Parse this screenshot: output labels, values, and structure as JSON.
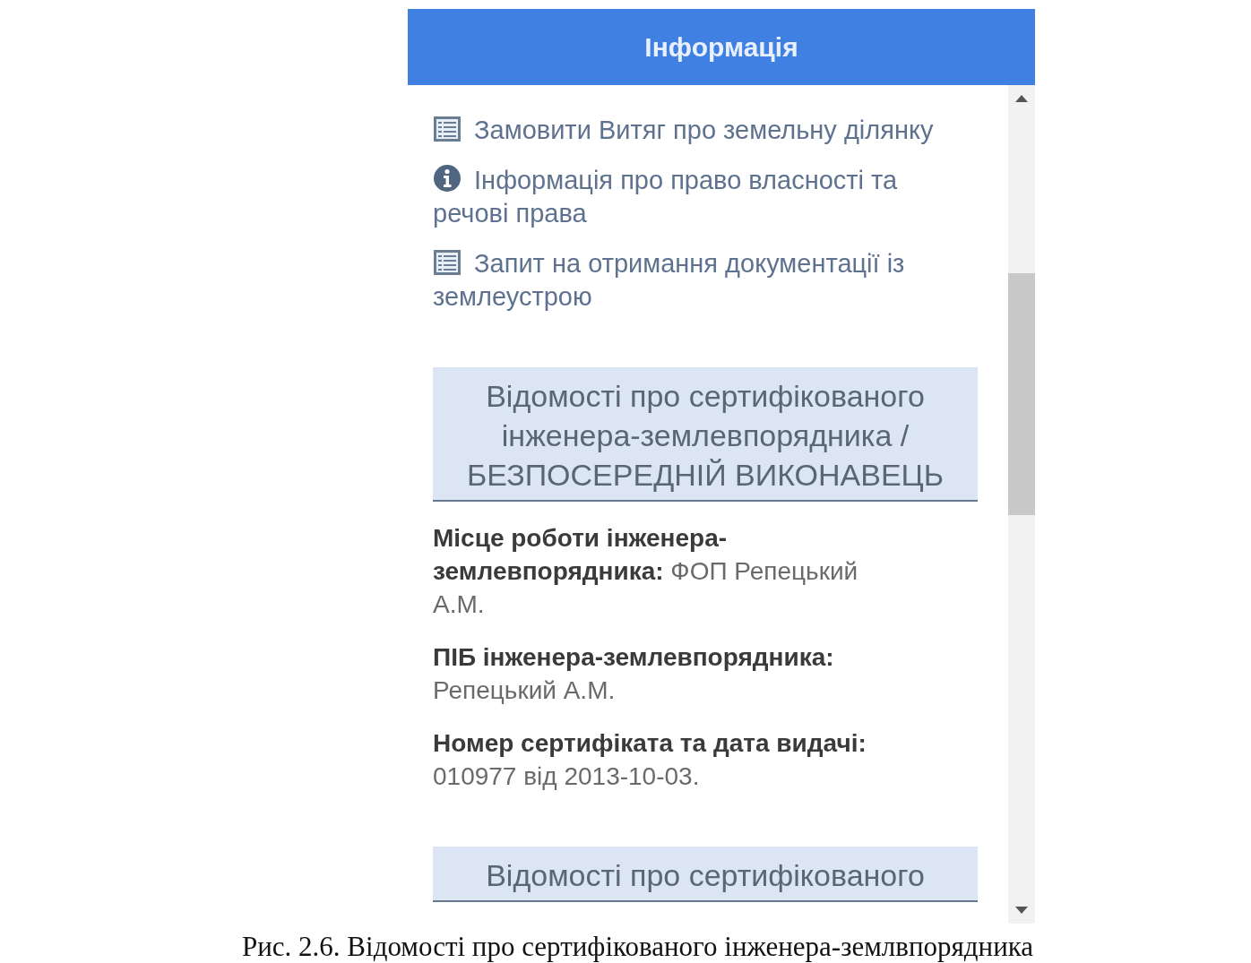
{
  "panel": {
    "title": "Інформація"
  },
  "links": [
    {
      "kind": "document",
      "text": "Замовити Витяг про земельну ділянку"
    },
    {
      "kind": "info",
      "text": "Інформація про право власності та речові права"
    },
    {
      "kind": "document",
      "text": "Запит на отримання документації із землеустрою"
    }
  ],
  "sections": [
    {
      "heading": "Відомості про сертифікованого інженера-землевпорядника / БЕЗПОСЕРЕДНІЙ ВИКОНАВЕЦЬ",
      "fields": [
        "**Місце роботи інженера-землевпорядника:** ФОП Репецький А.М.",
        "**ПІБ інженера-землевпорядника:** Репецький А.М.",
        "**Номер сертифіката та дата видачі:** 010977 від 2013-10-03."
      ]
    },
    {
      "heading": "Відомості про сертифікованого"
    }
  ],
  "caption": "Рис. 2.6. Відомості про сертифікованого інженера-землвпорядника"
}
